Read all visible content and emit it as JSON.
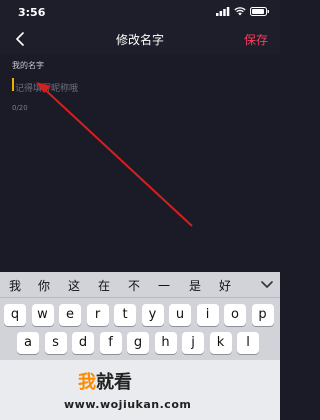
{
  "status_bar": {
    "time": "3:56",
    "icons": [
      "signal-icon",
      "wifi-icon",
      "battery-icon"
    ]
  },
  "nav": {
    "title": "修改名字",
    "save_label": "保存",
    "back_icon": "chevron-left-icon"
  },
  "form": {
    "field_label": "我的名字",
    "input_value": "",
    "input_placeholder": "记得填写昵称哦",
    "char_count": "0/20"
  },
  "colors": {
    "background": "#1a1b26",
    "accent": "#ff3b5c",
    "annotation_arrow": "#d91e1e",
    "caret": "#e9b300"
  },
  "keyboard": {
    "candidates": [
      "我",
      "你",
      "这",
      "在",
      "不",
      "一",
      "是",
      "好"
    ],
    "row1": [
      "q",
      "w",
      "e",
      "r",
      "t",
      "y",
      "u",
      "i",
      "o",
      "p"
    ],
    "row2": [
      "a",
      "s",
      "d",
      "f",
      "g",
      "h",
      "j",
      "k",
      "l"
    ]
  },
  "watermark": {
    "brand_first": "我",
    "brand_rest": "就看",
    "url": "www.wojiukan.com"
  }
}
